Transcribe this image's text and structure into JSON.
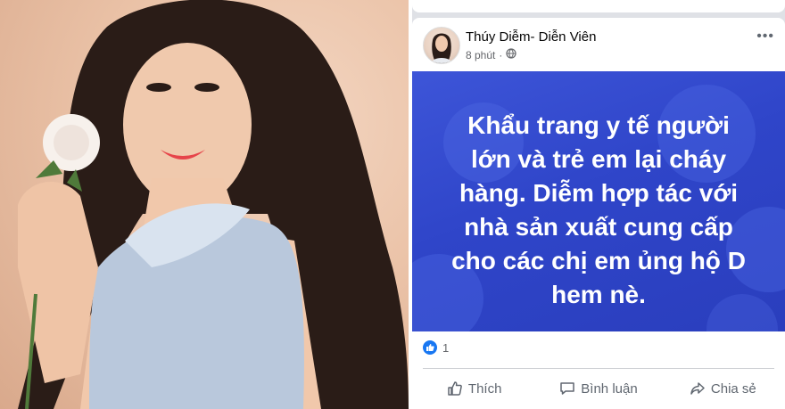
{
  "post": {
    "author": "Thúy Diễm- Diễn Viên",
    "time": "8 phút",
    "more_label": "•••",
    "banner_text": "Khẩu trang y tế người\nlớn và trẻ em lại cháy\nhàng. Diễm hợp tác với\nnhà sản xuất cung cấp\ncho các chị em ủng hộ D\nhem nè.",
    "reaction_count": "1",
    "actions": {
      "like": "Thích",
      "comment": "Bình luận",
      "share": "Chia sẻ"
    }
  },
  "colors": {
    "banner": "#3d55d8",
    "like_blue": "#1877f2",
    "photo_bg": "#ebc3a8"
  },
  "icons": [
    "globe-icon",
    "like-icon",
    "comment-icon",
    "share-icon",
    "more-icon"
  ]
}
